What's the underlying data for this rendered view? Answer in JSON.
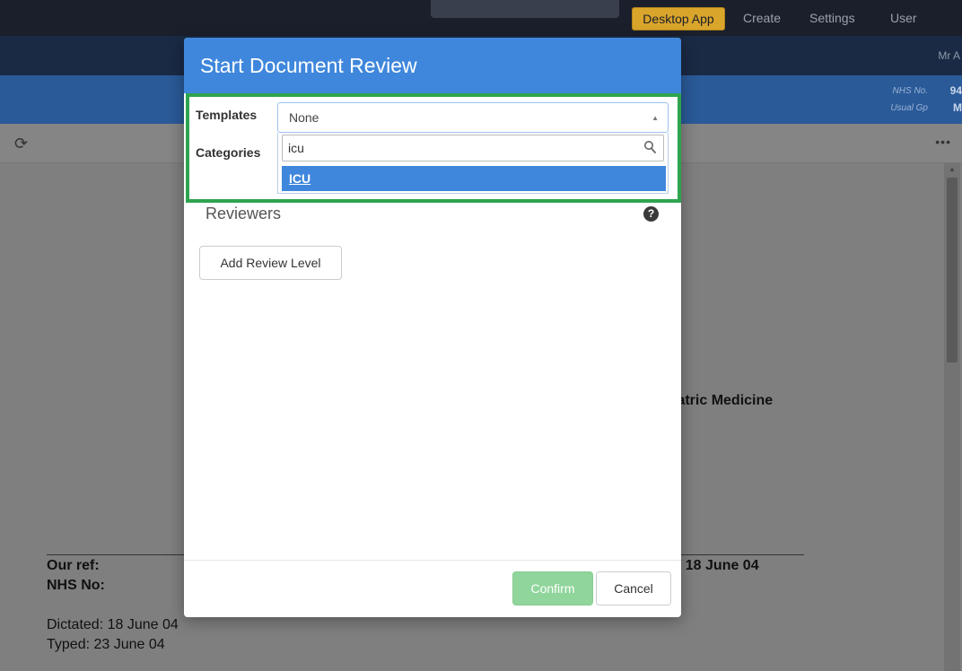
{
  "topnav": {
    "desktop_app": "Desktop App",
    "create": "Create",
    "settings": "Settings",
    "user": "User"
  },
  "userbar": {
    "user_name": "Mr A"
  },
  "patient": {
    "nhs_label": "NHS No.",
    "nhs_value": "94",
    "gp_label": "Usual Gp",
    "gp_value": "M"
  },
  "document": {
    "specialty_fragment": "iatric Medicine",
    "our_ref_label": "Our ref:",
    "nhs_no_label": "NHS No:",
    "date_fragment": ": 18 June 04",
    "dictated": "Dictated: 18 June 04",
    "typed": "Typed: 23 June 04"
  },
  "modal": {
    "title": "Start Document Review",
    "templates_label": "Templates",
    "templates_value": "None",
    "categories_label": "Categories",
    "search_value": "icu",
    "option_icu": "ICU",
    "reviewers_label": "Reviewers",
    "help_glyph": "?",
    "add_review_level": "Add Review Level",
    "confirm": "Confirm",
    "cancel": "Cancel"
  },
  "colors": {
    "header_blue": "#3f87dc",
    "highlight_green": "#2ea44f",
    "confirm_green": "#90d59b",
    "desktop_app_gold": "#d9a52a"
  }
}
